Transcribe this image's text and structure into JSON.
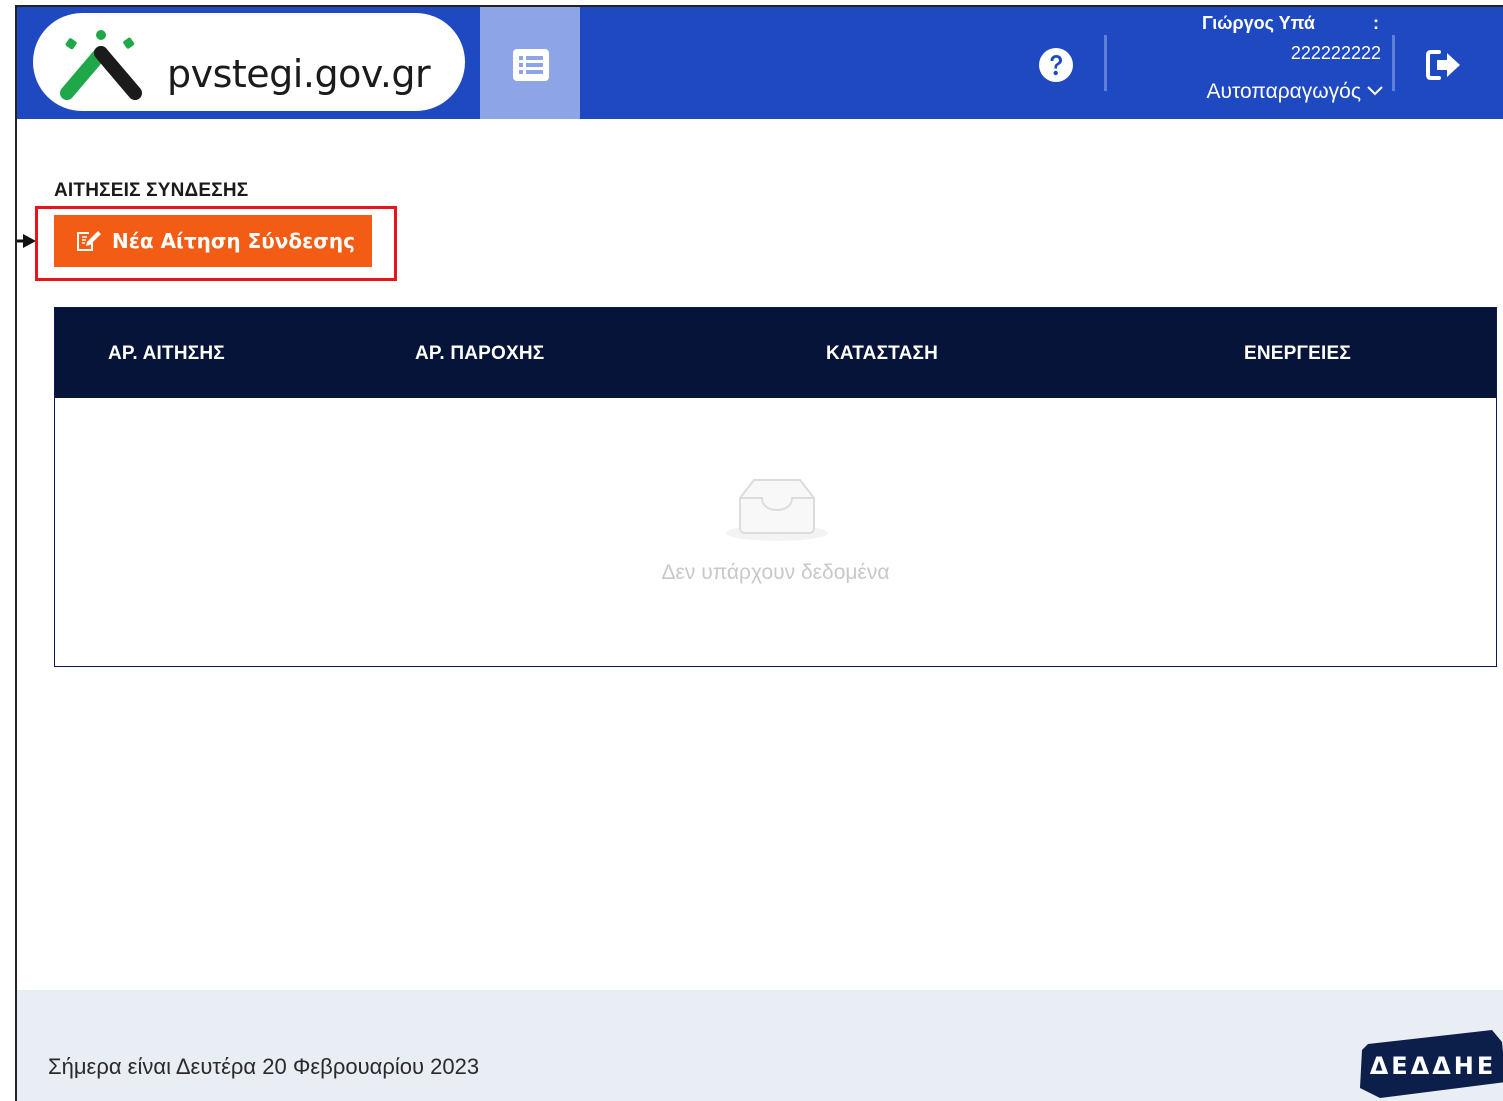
{
  "header": {
    "logo_text": "pvstegi.gov.gr",
    "user_name": "Γιώργος Υπά",
    "user_colon": ":",
    "user_id": "222222222",
    "user_role": "Αυτοπαραγωγός",
    "icons": {
      "logo": "pvstegi-logo-mark",
      "menu": "list-icon",
      "help": "question-circle-icon",
      "role_dropdown": "chevron-down-icon",
      "logout": "sign-out-icon"
    }
  },
  "main": {
    "section_title": "ΑΙΤΗΣΕΙΣ ΣΥΝΔΕΣΗΣ",
    "new_request_button": "Νέα Αίτηση Σύνδεσης",
    "new_request_icon": "edit-document-icon",
    "table": {
      "columns": [
        "ΑΡ. ΑΙΤΗΣΗΣ",
        "ΑΡ. ΠΑΡΟΧΗΣ",
        "ΚΑΤΑΣΤΑΣΗ",
        "ΕΝΕΡΓΕΙΕΣ"
      ],
      "rows": [],
      "empty_text": "Δεν υπάρχουν δεδομένα",
      "empty_icon": "empty-inbox-icon"
    }
  },
  "footer": {
    "date_text": "Σήμερα είναι Δευτέρα 20 Φεβρουαρίου 2023",
    "brand": "ΔΕΔΔΗΕ"
  },
  "colors": {
    "header_bg": "#1f49c0",
    "menu_toggle_bg": "#8da4e6",
    "button_bg": "#f25c14",
    "highlight": "#e8141b",
    "table_header_bg": "#06143a",
    "footer_bg": "#e9edf4",
    "logo_green": "#1fa84a"
  }
}
